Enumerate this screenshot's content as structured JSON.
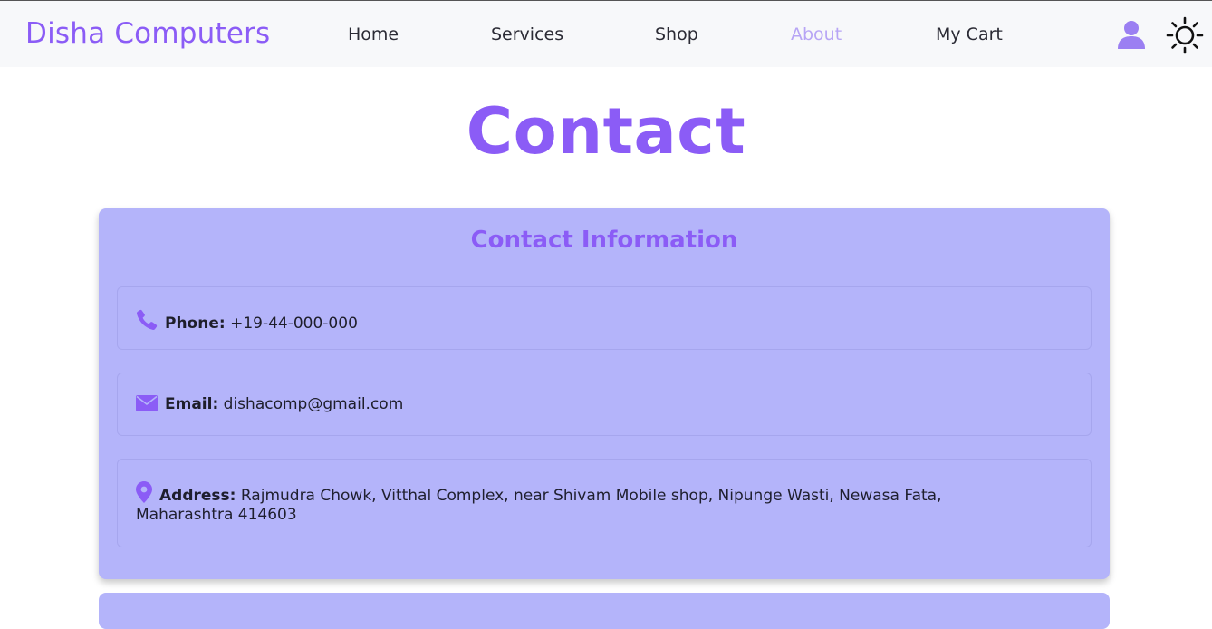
{
  "brand": "Disha Computers",
  "nav": {
    "home": "Home",
    "services": "Services",
    "shop": "Shop",
    "about": "About",
    "cart": "My Cart"
  },
  "icons": {
    "user": "user-icon",
    "theme": "sun-icon"
  },
  "colors": {
    "accent": "#8b5cf6",
    "card": "#b4b4fa",
    "active_nav": "#b7a5f5"
  },
  "page_title": "Contact",
  "contact": {
    "title": "Contact Information",
    "phone_label": "Phone:",
    "phone_value": "+19-44-000-000",
    "email_label": "Email:",
    "email_value": "dishacomp@gmail.com",
    "address_label": "Address:",
    "address_line1": "Rajmudra Chowk, Vitthal Complex, near Shivam Mobile shop, Nipunge Wasti, Newasa Fata,",
    "address_line2": "Maharashtra 414603"
  }
}
